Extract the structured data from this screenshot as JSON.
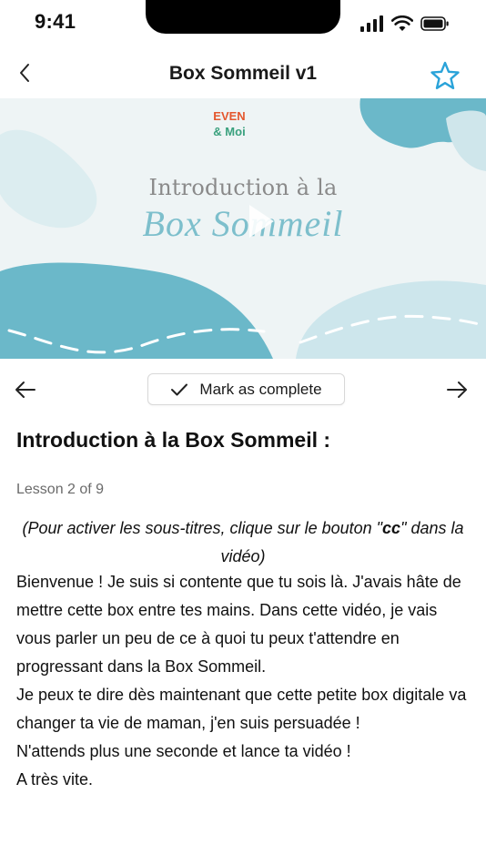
{
  "status_bar": {
    "time": "9:41"
  },
  "nav": {
    "title": "Box Sommeil v1"
  },
  "video": {
    "logo_line1": "EVEN",
    "logo_line2": "& Moi",
    "title_line1": "Introduction à la",
    "title_line2": "Box Sommeil"
  },
  "lesson_nav": {
    "complete_label": "Mark as complete"
  },
  "content": {
    "title": "Introduction à la Box Sommeil :",
    "counter": "Lesson 2 of 9",
    "note_prefix": "(Pour activer les sous-titres, clique sur le bouton \"",
    "note_cc": "cc",
    "note_suffix": "\" dans la vidéo)",
    "paragraphs": [
      "Bienvenue ! Je suis si contente que tu sois là. J'avais hâte de mettre cette box entre tes mains. Dans cette vidéo, je vais vous parler un peu de ce à quoi tu peux t'attendre en progressant dans la Box Sommeil.",
      "Je peux te dire dès maintenant que cette petite box digitale va changer ta vie de maman, j'en suis persuadée !",
      "N'attends plus une seconde et lance ta vidéo !",
      "A très vite."
    ]
  },
  "colors": {
    "accent_star": "#2aa3d9",
    "teal": "#6bb8c9",
    "light_teal": "#bfe1e8"
  }
}
